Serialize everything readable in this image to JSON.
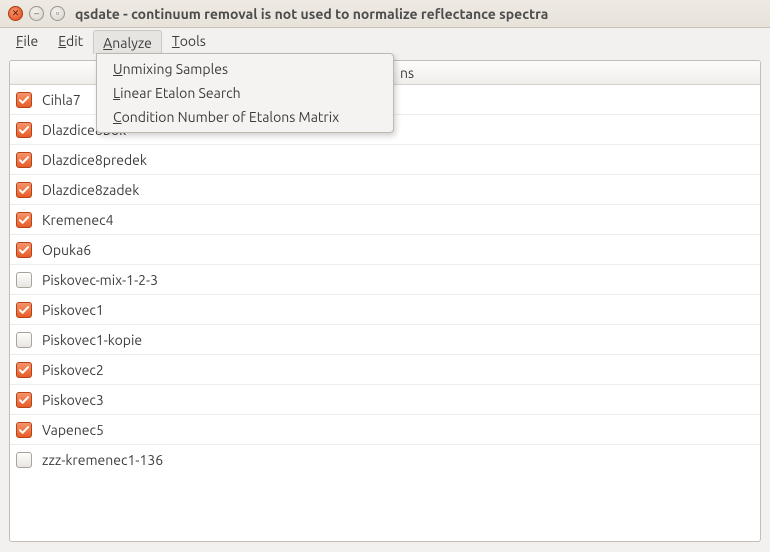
{
  "window": {
    "title": "qsdate - continuum removal is not used to normalize reflectance spectra"
  },
  "menubar": {
    "file": {
      "label": "File",
      "accel_index": 0
    },
    "edit": {
      "label": "Edit",
      "accel_index": 0
    },
    "analyze": {
      "label": "Analyze",
      "accel_index": 0,
      "open": true
    },
    "tools": {
      "label": "Tools",
      "accel_index": 0
    }
  },
  "analyze_menu": {
    "items": [
      {
        "label": "Unmixing Samples",
        "accel_index": 0
      },
      {
        "label": "Linear Etalon Search",
        "accel_index": 0
      },
      {
        "label": "Condition Number of Etalons Matrix",
        "accel_index": 0
      }
    ]
  },
  "list": {
    "header_visible_fragment": "ns",
    "rows": [
      {
        "checked": true,
        "label": "Cihla7"
      },
      {
        "checked": true,
        "label": "Dlazdice8bok"
      },
      {
        "checked": true,
        "label": "Dlazdice8predek"
      },
      {
        "checked": true,
        "label": "Dlazdice8zadek"
      },
      {
        "checked": true,
        "label": "Kremenec4"
      },
      {
        "checked": true,
        "label": "Opuka6"
      },
      {
        "checked": false,
        "label": "Piskovec-mix-1-2-3"
      },
      {
        "checked": true,
        "label": "Piskovec1"
      },
      {
        "checked": false,
        "label": "Piskovec1-kopie"
      },
      {
        "checked": true,
        "label": "Piskovec2"
      },
      {
        "checked": true,
        "label": "Piskovec3"
      },
      {
        "checked": true,
        "label": "Vapenec5"
      },
      {
        "checked": false,
        "label": "zzz-kremenec1-136"
      }
    ]
  }
}
